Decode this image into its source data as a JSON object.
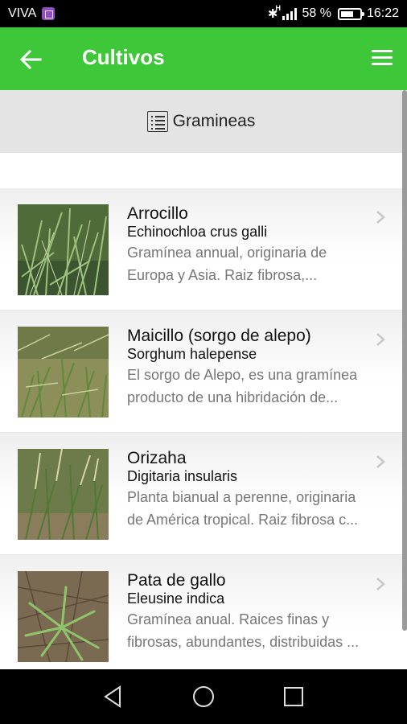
{
  "status_bar": {
    "carrier": "VIVA",
    "battery": "58 %",
    "battery_level": 0.58,
    "time": "16:22",
    "network": "H"
  },
  "app_bar": {
    "title": "Cultivos",
    "color": "#3fc73a"
  },
  "category": {
    "label": "Gramineas"
  },
  "items": [
    {
      "name": "Arrocillo",
      "scientific": "Echinochloa crus galli",
      "desc_line1": "Gramínea annual, originaria de",
      "desc_line2": "Europa y Asia. Raiz fibrosa,..."
    },
    {
      "name": "Maicillo (sorgo de alepo)",
      "scientific": "Sorghum halepense",
      "desc_line1": "El sorgo de Alepo, es una gramínea",
      "desc_line2": "producto de una hibridación de..."
    },
    {
      "name": "Orizaha",
      "scientific": "Digitaria insularis",
      "desc_line1": "Planta bianual a perenne, originaria",
      "desc_line2": "de América tropical. Raiz fibrosa c..."
    },
    {
      "name": "Pata de gallo",
      "scientific": "Eleusine indica",
      "desc_line1": "Gramínea anual. Raices finas y",
      "desc_line2": "fibrosas, abundantes, distribuidas ..."
    }
  ]
}
